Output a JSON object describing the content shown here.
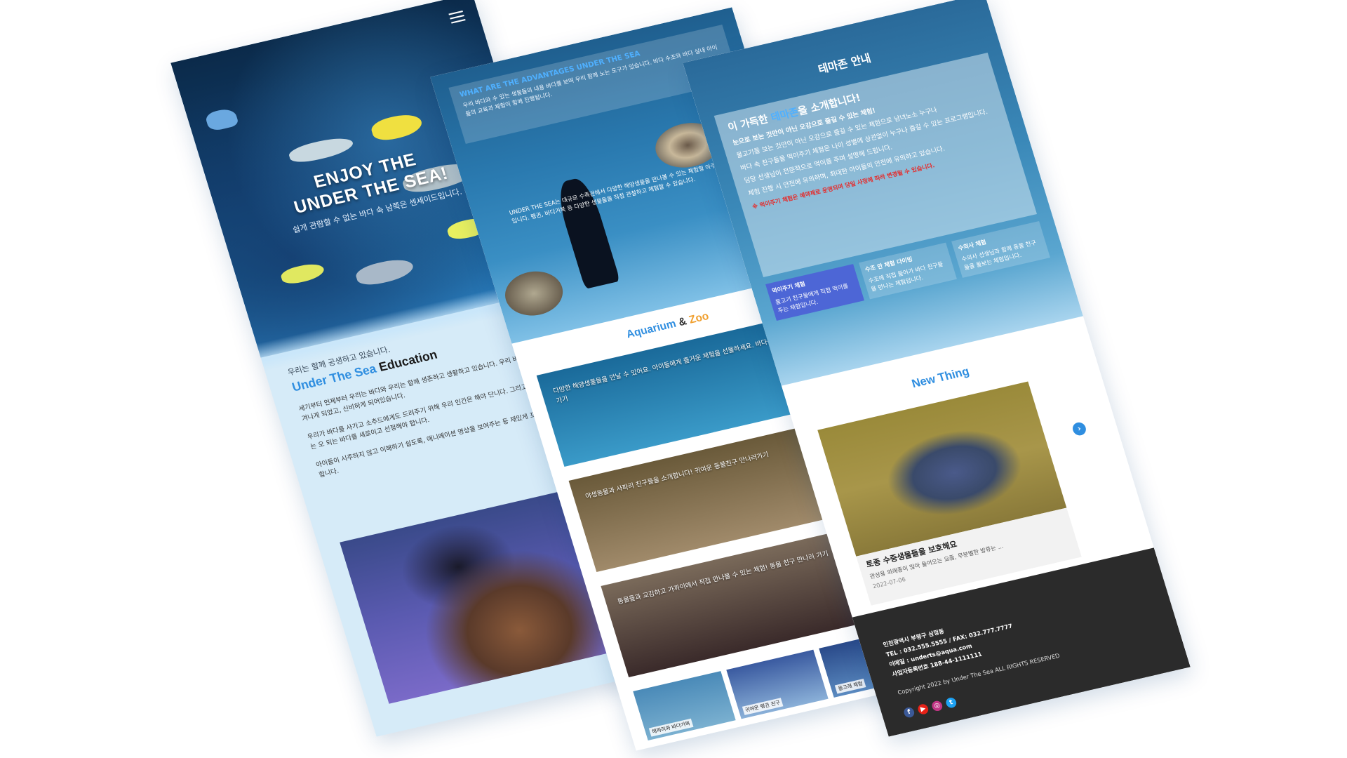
{
  "panel1": {
    "hero_title_line1": "ENJOY THE",
    "hero_title_line2": "UNDER THE SEA!",
    "hero_subtitle": "쉽게 관람할 수 없는 바다 속 남쪽은 센세이드입니다.",
    "edu_kicker": "우리는 함께 공생하고 있습니다.",
    "edu_title_blue": "Under The Sea",
    "edu_title_dark": "Education",
    "paragraphs": [
      "세기부터 언제부터 우리는 바다와 우리는 함께 생존하고 생활하고 있습니다. 우리 바다는 이렇게 생겨나게 되었고, 신비하게 되어있습니다.",
      "우리가 바다를 사가고 소추드에게도 드려주기 위해 우리 인간은 해야 단니다. 그리고, 우리가 해체는 오 되는 바다를 새로이고 선정해야 합니다.",
      "아이들이 시주하지 않고 이해하기 쉽도록, 애니메이션 영상을 보여주는 등 재밌게 프로그램을 진행합니다."
    ]
  },
  "panel2": {
    "box_title": "WHAT ARE THE ADVANTAGES UNDER THE SEA",
    "box_text": "우리 바다와 수 있는 생물들의 내용 바다를 보며 우리 함께 노는 도구가 있습니다. 바다 수조와 바다 실내 아이들의 교육과 체험이 함께 진행됩니다.",
    "intro_text": "UNDER THE SEA는 대규모 수족관에서 다양한 해양생물을 만나볼 수 있는 체험형 아쿠아리움입니다. 펭귄, 바다거북 등 다양한 생물들을 직접 관찰하고 체험할 수 있습니다.",
    "section_title_a": "Aquarium",
    "section_title_amp": "&",
    "section_title_b": "Zoo",
    "cards": [
      {
        "caption": "다양한 해양생물들을 만날 수 있어요. 아이들에게 즐거운 체험을 선물하세요. 바다생물 친구들 보러가기"
      },
      {
        "caption": "야생동물과 사파리 친구들을 소개합니다! 귀여운 동물친구 만나러가기"
      },
      {
        "caption": "동물들과 교감하고 가까이에서 직접 만나볼 수 있는 체험! 동물 친구 만나러 가기"
      }
    ],
    "thumbs": [
      "해파리와 바다거북",
      "귀여운 펭귄 친구",
      "돌고래 체험"
    ]
  },
  "panel3": {
    "heading": "테마존 안내",
    "big_pre": "이 가득한",
    "big_hl": "테마존",
    "big_post": "을 소개합니다!",
    "big_line2": "눈으로 보는 것만이 아닌 오감으로 즐길 수 있는 체험!",
    "lines": [
      "물고기를 보는 것만이 아닌 오감으로 즐길 수 있는 체험으로 남녀노소 누구나",
      "바다 속 친구들을 먹이주기 체험은 나이 성별에 상관없이 누구나 즐길 수 있는 프로그램입니다.",
      "담당 선생님이 전문적으로 먹이를 주며 설명해 드립니다.",
      "체험 진행 시 안전에 유의하며, 최대한 아이들의 안전에 유의하고 있습니다."
    ],
    "red_line": "※ 먹이주기 체험은 예약제로 운영되며 당일 사정에 따라 변경될 수 있습니다.",
    "cols": [
      {
        "title": "먹이주기 체험",
        "text": "물고기 친구들에게 직접 먹이를 주는 체험입니다."
      },
      {
        "title": "수조 안 체험 다이빙",
        "text": "수조에 직접 들어가 바다 친구들을 만나는 체험입니다."
      },
      {
        "title": "수의사 체험",
        "text": "수의사 선생님과 함께 동물 친구들을 돌보는 체험입니다."
      }
    ],
    "new_title": "New Thing",
    "news_title": "토종 수중생물들을 보호해요",
    "news_text": "관상용 외래종이 많아 들어오는 요즘, 무분별한 방류는 ...",
    "news_date": "2022-07-06",
    "next_icon": "›",
    "footer": {
      "address": "인천광역시 부평구 삼정동",
      "tel": "TEL : 032.555.5555 / FAX: 032.777.7777",
      "email": "이메일 : underts@aqua.com",
      "biz": "사업자등록번호 188-44-1111111",
      "copyright": "Copyright 2022 by Under The Sea ALL RIGHTS RESERVED"
    },
    "social": [
      {
        "name": "facebook-icon",
        "glyph": "f",
        "color": "#3b5998"
      },
      {
        "name": "youtube-icon",
        "glyph": "▶",
        "color": "#e62117"
      },
      {
        "name": "instagram-icon",
        "glyph": "◎",
        "color": "#c13584"
      },
      {
        "name": "twitter-icon",
        "glyph": "t",
        "color": "#1da1f2"
      }
    ]
  },
  "colors": {
    "accent_blue": "#2f8ee0",
    "accent_orange": "#f0a030",
    "footer_bg": "#2b2b2b"
  }
}
